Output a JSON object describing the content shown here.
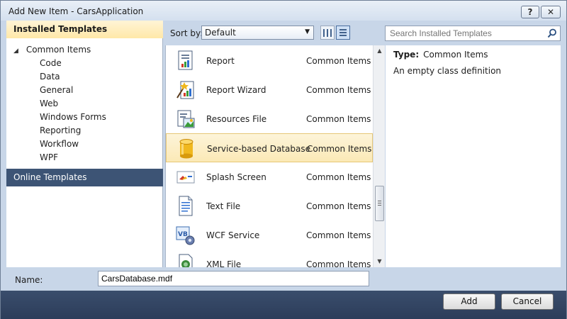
{
  "window": {
    "title": "Add New Item - CarsApplication",
    "help_label": "?",
    "close_label": "✕"
  },
  "left": {
    "installed_header": "Installed Templates",
    "root": {
      "arrow": "◢",
      "label": "Common Items"
    },
    "children": [
      "Code",
      "Data",
      "General",
      "Web",
      "Windows Forms",
      "Reporting",
      "Workflow",
      "WPF"
    ],
    "online_header": "Online Templates"
  },
  "toolbar": {
    "sort_label": "Sort by:",
    "sort_value": "Default",
    "dropdown_glyph": "▼"
  },
  "items": [
    {
      "name": "Report",
      "category": "Common Items",
      "icon": "report-icon"
    },
    {
      "name": "Report Wizard",
      "category": "Common Items",
      "icon": "report-wizard-icon"
    },
    {
      "name": "Resources File",
      "category": "Common Items",
      "icon": "resources-file-icon"
    },
    {
      "name": "Service-based Database",
      "category": "Common Items",
      "icon": "database-icon",
      "selected": true
    },
    {
      "name": "Splash Screen",
      "category": "Common Items",
      "icon": "splash-screen-icon"
    },
    {
      "name": "Text File",
      "category": "Common Items",
      "icon": "text-file-icon"
    },
    {
      "name": "WCF Service",
      "category": "Common Items",
      "icon": "wcf-service-icon"
    },
    {
      "name": "XML File",
      "category": "Common Items",
      "icon": "xml-file-icon"
    }
  ],
  "scrollbar": {
    "up": "▲",
    "down": "▼"
  },
  "search": {
    "placeholder": "Search Installed Templates"
  },
  "details": {
    "type_label": "Type:",
    "type_value": "Common Items",
    "description": "An empty class definition"
  },
  "name_row": {
    "label": "Name:",
    "value": "CarsDatabase.mdf"
  },
  "buttons": {
    "add": "Add",
    "cancel": "Cancel"
  },
  "colors": {
    "selection": "#fbe9b6",
    "online_header": "#3d5475",
    "accent_gold": "#f0b81e"
  }
}
